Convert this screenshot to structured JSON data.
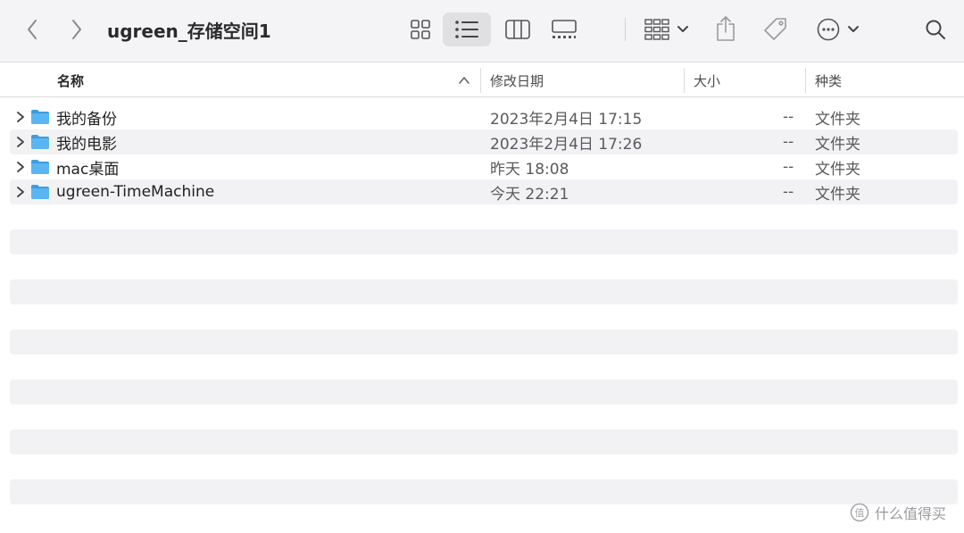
{
  "window": {
    "title": "ugreen_存储空间1"
  },
  "toolbar": {
    "icons": [
      "chevron-left-icon",
      "chevron-right-icon",
      "icon-view-icon",
      "list-view-icon",
      "column-view-icon",
      "gallery-view-icon",
      "group-icon",
      "share-icon",
      "tag-icon",
      "more-icon",
      "search-icon"
    ],
    "active_view": "list"
  },
  "columns": {
    "name": "名称",
    "date": "修改日期",
    "size": "大小",
    "kind": "种类",
    "sort": "name-ascending"
  },
  "files": [
    {
      "name": "我的备份",
      "date": "2023年2月4日 17:15",
      "size": "--",
      "kind": "文件夹"
    },
    {
      "name": "我的电影",
      "date": "2023年2月4日 17:26",
      "size": "--",
      "kind": "文件夹"
    },
    {
      "name": "mac桌面",
      "date": "昨天 18:08",
      "size": "--",
      "kind": "文件夹"
    },
    {
      "name": "ugreen-TimeMachine",
      "date": "今天 22:21",
      "size": "--",
      "kind": "文件夹"
    }
  ],
  "watermark": {
    "text": "什么值得买"
  },
  "colors": {
    "folder": "#4fb0f0",
    "folder_tab": "#3d9de0",
    "stripe": "#f2f2f4",
    "toolbar": "#f4f4f6"
  }
}
